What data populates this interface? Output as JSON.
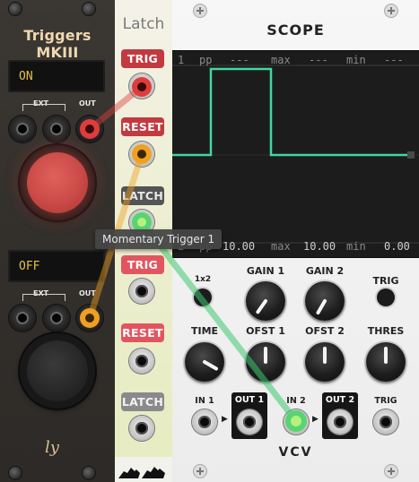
{
  "triggers_module": {
    "title": "Triggers MKIII",
    "top": {
      "display": "ON",
      "ext_label": "EXT",
      "out_label": "OUT"
    },
    "bottom": {
      "display": "OFF",
      "ext_label": "EXT",
      "out_label": "OUT"
    },
    "logo": "ly",
    "button_colors": {
      "top": "#c94a46",
      "bottom": "#262626"
    }
  },
  "latch_module": {
    "title": "Latch",
    "buttons": [
      "TRIG",
      "RESET",
      "LATCH",
      "TRIG",
      "RESET",
      "LATCH"
    ]
  },
  "scope_module": {
    "title": "SCOPE",
    "display_top": {
      "channel": "1",
      "pp_label": "pp",
      "pp_value": "---",
      "max_label": "max",
      "max_value": "---",
      "min_label": "min",
      "min_value": "---"
    },
    "display_bottom": {
      "channel": "2",
      "pp_label": "pp",
      "pp_value": "10.00",
      "max_label": "max",
      "max_value": "10.00",
      "min_label": "min",
      "min_value": "0.00"
    },
    "trace_color": "#40d8a0",
    "knob_labels": {
      "x2": "1x2",
      "gain1": "GAIN 1",
      "gain2": "GAIN 2",
      "trig": "TRIG",
      "time": "TIME",
      "ofst1": "OFST 1",
      "ofst2": "OFST 2",
      "thres": "THRES"
    },
    "ports": {
      "in1": "IN 1",
      "out1": "OUT 1",
      "in2": "IN 2",
      "out2": "OUT 2",
      "trig": "TRIG"
    },
    "logo": "VCV"
  },
  "tooltip": "Momentary Trigger 1",
  "cable_colors": {
    "red": "#e04040",
    "orange": "#f0a020",
    "green": "#40c870"
  }
}
